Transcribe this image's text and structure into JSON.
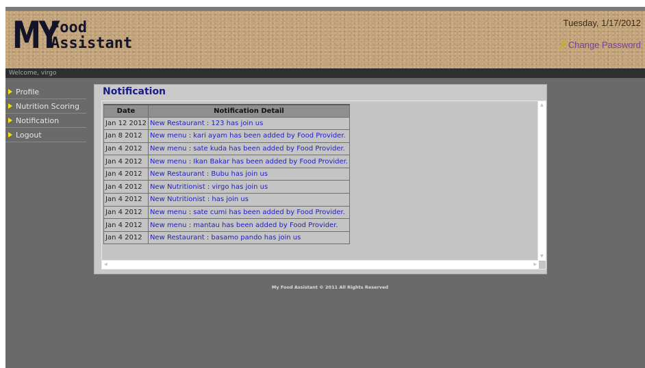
{
  "logo": {
    "my": "MY",
    "food": "Food",
    "assistant": "Assistant"
  },
  "header": {
    "date": "Tuesday, 1/17/2012",
    "change_password": "Change Password"
  },
  "welcome": "Welcome, virgo",
  "sidebar": {
    "items": [
      {
        "label": "Profile"
      },
      {
        "label": "Nutrition Scoring"
      },
      {
        "label": "Notification"
      },
      {
        "label": "Logout"
      }
    ]
  },
  "panel": {
    "title": "Notification",
    "columns": {
      "date": "Date",
      "detail": "Notification Detail"
    },
    "rows": [
      {
        "date": "Jan 12 2012",
        "detail": "New Restaurant : 123 has join us"
      },
      {
        "date": "Jan 8 2012",
        "detail": "New menu : kari ayam has been added by Food Provider."
      },
      {
        "date": "Jan 4 2012",
        "detail": "New menu : sate kuda has been added by Food Provider."
      },
      {
        "date": "Jan 4 2012",
        "detail": "New menu : Ikan Bakar has been added by Food Provider."
      },
      {
        "date": "Jan 4 2012",
        "detail": "New Restaurant : Bubu has join us"
      },
      {
        "date": "Jan 4 2012",
        "detail": "New Nutritionist : virgo has join us"
      },
      {
        "date": "Jan 4 2012",
        "detail": "New Nutritionist : has join us"
      },
      {
        "date": "Jan 4 2012",
        "detail": "New menu : sate cumi has been added by Food Provider."
      },
      {
        "date": "Jan 4 2012",
        "detail": "New menu : mantau has been added by Food Provider."
      },
      {
        "date": "Jan 4 2012",
        "detail": "New Restaurant : basamo pando has join us"
      }
    ]
  },
  "footer": "My Food Assistant © 2011 All Rights Reserved",
  "colors": {
    "header_bg": "#c2a37a",
    "page_bg": "#6a6a6a",
    "panel_bg": "#c9c9c9",
    "title": "#1a1a8a",
    "link": "#2020c8",
    "menu_arrow": "#f5e400"
  },
  "icons": {
    "menu_arrow": "triangle-right-icon",
    "change_password": "key-icon"
  }
}
